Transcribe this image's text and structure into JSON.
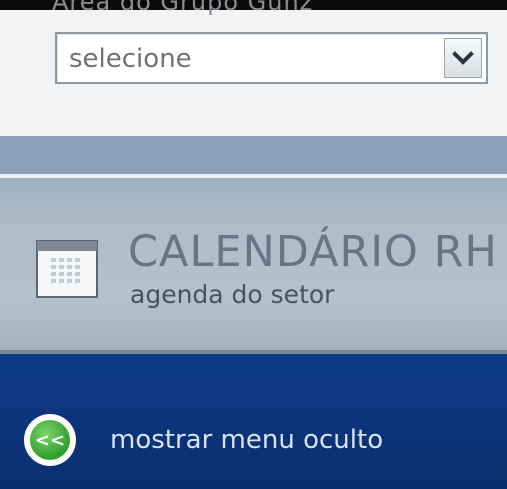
{
  "header": {
    "clipped_label": "Área do Grupo Gunz"
  },
  "filter": {
    "select_value": "selecione",
    "arrow_icon": "chevron-down-icon"
  },
  "calendar": {
    "title": "CALENDÁRIO RH",
    "subtitle": "agenda do setor",
    "icon": "calendar-icon"
  },
  "nav": {
    "show_menu_label": "mostrar menu oculto",
    "show_menu_icon": "double-chevron-left-icon",
    "show_menu_glyph": "<<"
  },
  "colors": {
    "nav_background": "#0b347c",
    "banner_background": "#aebdc9",
    "accent_green": "#2f9e2c"
  }
}
